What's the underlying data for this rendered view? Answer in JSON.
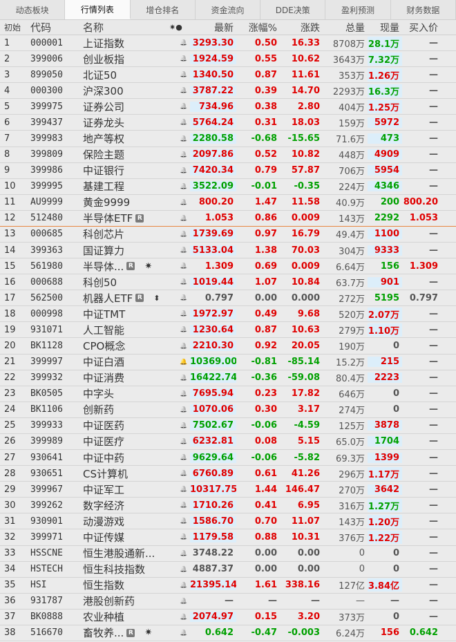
{
  "tabs": [
    "动态板块",
    "行情列表",
    "增仓排名",
    "资金流向",
    "DDE决策",
    "盈利预测",
    "财务数据"
  ],
  "active_tab": 1,
  "header": {
    "idx": "初始",
    "code": "代码",
    "name": "名称",
    "mark": "✷●",
    "price": "最新",
    "pct": "涨幅%",
    "chg": "涨跌",
    "vol": "总量",
    "now": "现量",
    "bid": "买入价"
  },
  "rows": [
    {
      "idx": "1",
      "code": "000001",
      "name": "上证指数",
      "price": "3293.30",
      "pct": "0.50",
      "chg": "16.33",
      "vol": "8708万",
      "now": "28.1万",
      "bid": "—",
      "pc": "red",
      "nc": "green",
      "hlp": true,
      "hln": true
    },
    {
      "idx": "2",
      "code": "399006",
      "name": "创业板指",
      "price": "1924.59",
      "pct": "0.55",
      "chg": "10.62",
      "vol": "3643万",
      "now": "7.32万",
      "bid": "—",
      "pc": "red",
      "nc": "green",
      "hlp": true,
      "hln": true
    },
    {
      "idx": "3",
      "code": "899050",
      "name": "北证50",
      "price": "1340.50",
      "pct": "0.87",
      "chg": "11.61",
      "vol": "353万",
      "now": "1.26万",
      "bid": "—",
      "pc": "red",
      "nc": "red",
      "hlp": true,
      "hln": true
    },
    {
      "idx": "4",
      "code": "000300",
      "name": "沪深300",
      "price": "3787.22",
      "pct": "0.39",
      "chg": "14.70",
      "vol": "2293万",
      "now": "16.3万",
      "bid": "—",
      "pc": "red",
      "nc": "green",
      "hlp": true,
      "hln": true
    },
    {
      "idx": "5",
      "code": "399975",
      "name": "证券公司",
      "price": "734.96",
      "pct": "0.38",
      "chg": "2.80",
      "vol": "404万",
      "now": "1.25万",
      "bid": "—",
      "pc": "red",
      "nc": "red",
      "hlp": true,
      "hln": true
    },
    {
      "idx": "6",
      "code": "399437",
      "name": "证券龙头",
      "price": "5764.24",
      "pct": "0.31",
      "chg": "18.03",
      "vol": "159万",
      "now": "5972",
      "bid": "—",
      "pc": "red",
      "nc": "red",
      "hlp": true,
      "hln": true
    },
    {
      "idx": "7",
      "code": "399983",
      "name": "地产等权",
      "price": "2280.58",
      "pct": "-0.68",
      "chg": "-15.65",
      "vol": "71.6万",
      "now": "473",
      "bid": "—",
      "pc": "green",
      "nc": "green",
      "hlp": true,
      "hln": true
    },
    {
      "idx": "8",
      "code": "399809",
      "name": "保险主题",
      "price": "2097.86",
      "pct": "0.52",
      "chg": "10.82",
      "vol": "448万",
      "now": "4909",
      "bid": "—",
      "pc": "red",
      "nc": "red",
      "hlp": true,
      "hln": true
    },
    {
      "idx": "9",
      "code": "399986",
      "name": "中证银行",
      "price": "7420.34",
      "pct": "0.79",
      "chg": "57.87",
      "vol": "706万",
      "now": "5954",
      "bid": "—",
      "pc": "red",
      "nc": "red",
      "hlp": true,
      "hln": true
    },
    {
      "idx": "10",
      "code": "399995",
      "name": "基建工程",
      "price": "3522.09",
      "pct": "-0.01",
      "chg": "-0.35",
      "vol": "224万",
      "now": "4346",
      "bid": "—",
      "pc": "green",
      "nc": "green",
      "hlp": true,
      "hln": true
    },
    {
      "idx": "11",
      "code": "AU9999",
      "name": "黄金9999",
      "price": "800.20",
      "pct": "1.47",
      "chg": "11.58",
      "vol": "40.9万",
      "now": "200",
      "bid": "800.20",
      "pc": "red",
      "nc": "green",
      "hlp": false,
      "hln": false
    },
    {
      "idx": "12",
      "code": "512480",
      "name": "半导体ETF",
      "badge": "R",
      "price": "1.053",
      "pct": "0.86",
      "chg": "0.009",
      "vol": "143万",
      "now": "2292",
      "bid": "1.053",
      "pc": "red",
      "nc": "green",
      "hlp": false,
      "hln": false,
      "sep": true
    },
    {
      "idx": "13",
      "code": "000685",
      "name": "科创芯片",
      "price": "1739.69",
      "pct": "0.97",
      "chg": "16.79",
      "vol": "49.4万",
      "now": "1100",
      "bid": "—",
      "pc": "red",
      "nc": "red",
      "hlp": true,
      "hln": true
    },
    {
      "idx": "14",
      "code": "399363",
      "name": "国证算力",
      "price": "5133.04",
      "pct": "1.38",
      "chg": "70.03",
      "vol": "304万",
      "now": "9333",
      "bid": "—",
      "pc": "red",
      "nc": "red",
      "hlp": true,
      "hln": true
    },
    {
      "idx": "15",
      "code": "561980",
      "name": "半导体...",
      "badge": "R",
      "star": "✷",
      "price": "1.309",
      "pct": "0.69",
      "chg": "0.009",
      "vol": "6.64万",
      "now": "156",
      "bid": "1.309",
      "pc": "red",
      "nc": "green",
      "hlp": false,
      "hln": false
    },
    {
      "idx": "16",
      "code": "000688",
      "name": "科创50",
      "price": "1019.44",
      "pct": "1.07",
      "chg": "10.84",
      "vol": "63.7万",
      "now": "901",
      "bid": "—",
      "pc": "red",
      "nc": "red",
      "hlp": true,
      "hln": true
    },
    {
      "idx": "17",
      "code": "562500",
      "name": "机器人ETF",
      "badge": "R",
      "updn": "⬍",
      "price": "0.797",
      "pct": "0.00",
      "chg": "0.000",
      "vol": "272万",
      "now": "5195",
      "bid": "0.797",
      "pc": "gray",
      "nc": "green",
      "hlp": false,
      "hln": false
    },
    {
      "idx": "18",
      "code": "000998",
      "name": "中证TMT",
      "price": "1972.97",
      "pct": "0.49",
      "chg": "9.68",
      "vol": "520万",
      "now": "2.07万",
      "bid": "—",
      "pc": "red",
      "nc": "red",
      "hlp": true,
      "hln": true
    },
    {
      "idx": "19",
      "code": "931071",
      "name": "人工智能",
      "price": "1230.64",
      "pct": "0.87",
      "chg": "10.63",
      "vol": "279万",
      "now": "1.10万",
      "bid": "—",
      "pc": "red",
      "nc": "red",
      "hlp": true,
      "hln": true
    },
    {
      "idx": "20",
      "code": "BK1128",
      "name": "CPO概念",
      "price": "2210.30",
      "pct": "0.92",
      "chg": "20.05",
      "vol": "190万",
      "now": "0",
      "bid": "—",
      "pc": "red",
      "nc": "gray",
      "hlp": true,
      "hln": false
    },
    {
      "idx": "21",
      "code": "399997",
      "name": "中证白酒",
      "alert": true,
      "price": "10369.00",
      "pct": "-0.81",
      "chg": "-85.14",
      "vol": "15.2万",
      "now": "215",
      "bid": "—",
      "pc": "green",
      "nc": "red",
      "hlp": true,
      "hln": true
    },
    {
      "idx": "22",
      "code": "399932",
      "name": "中证消费",
      "price": "16422.74",
      "pct": "-0.36",
      "chg": "-59.08",
      "vol": "80.4万",
      "now": "2223",
      "bid": "—",
      "pc": "green",
      "nc": "red",
      "hlp": true,
      "hln": true
    },
    {
      "idx": "23",
      "code": "BK0505",
      "name": "中字头",
      "price": "7695.94",
      "pct": "0.23",
      "chg": "17.82",
      "vol": "646万",
      "now": "0",
      "bid": "—",
      "pc": "red",
      "nc": "gray",
      "hlp": true,
      "hln": false
    },
    {
      "idx": "24",
      "code": "BK1106",
      "name": "创新药",
      "price": "1070.06",
      "pct": "0.30",
      "chg": "3.17",
      "vol": "274万",
      "now": "0",
      "bid": "—",
      "pc": "red",
      "nc": "gray",
      "hlp": true,
      "hln": false
    },
    {
      "idx": "25",
      "code": "399933",
      "name": "中证医药",
      "price": "7502.67",
      "pct": "-0.06",
      "chg": "-4.59",
      "vol": "125万",
      "now": "3878",
      "bid": "—",
      "pc": "green",
      "nc": "red",
      "hlp": true,
      "hln": true
    },
    {
      "idx": "26",
      "code": "399989",
      "name": "中证医疗",
      "price": "6232.81",
      "pct": "0.08",
      "chg": "5.15",
      "vol": "65.0万",
      "now": "1704",
      "bid": "—",
      "pc": "red",
      "nc": "green",
      "hlp": true,
      "hln": true
    },
    {
      "idx": "27",
      "code": "930641",
      "name": "中证中药",
      "price": "9629.64",
      "pct": "-0.06",
      "chg": "-5.82",
      "vol": "69.3万",
      "now": "1399",
      "bid": "—",
      "pc": "green",
      "nc": "red",
      "hlp": true,
      "hln": true
    },
    {
      "idx": "28",
      "code": "930651",
      "name": "CS计算机",
      "price": "6760.89",
      "pct": "0.61",
      "chg": "41.26",
      "vol": "296万",
      "now": "1.17万",
      "bid": "—",
      "pc": "red",
      "nc": "red",
      "hlp": true,
      "hln": true
    },
    {
      "idx": "29",
      "code": "399967",
      "name": "中证军工",
      "price": "10317.75",
      "pct": "1.44",
      "chg": "146.47",
      "vol": "270万",
      "now": "3642",
      "bid": "—",
      "pc": "red",
      "nc": "red",
      "hlp": true,
      "hln": true
    },
    {
      "idx": "30",
      "code": "399262",
      "name": "数字经济",
      "price": "1710.26",
      "pct": "0.41",
      "chg": "6.95",
      "vol": "316万",
      "now": "1.27万",
      "bid": "—",
      "pc": "red",
      "nc": "green",
      "hlp": true,
      "hln": true
    },
    {
      "idx": "31",
      "code": "930901",
      "name": "动漫游戏",
      "price": "1586.70",
      "pct": "0.70",
      "chg": "11.07",
      "vol": "143万",
      "now": "1.20万",
      "bid": "—",
      "pc": "red",
      "nc": "red",
      "hlp": true,
      "hln": true
    },
    {
      "idx": "32",
      "code": "399971",
      "name": "中证传媒",
      "price": "1179.58",
      "pct": "0.88",
      "chg": "10.31",
      "vol": "376万",
      "now": "1.22万",
      "bid": "—",
      "pc": "red",
      "nc": "red",
      "hlp": true,
      "hln": true
    },
    {
      "idx": "33",
      "code": "HSSCNE",
      "name": "恒生港股通新...",
      "price": "3748.22",
      "pct": "0.00",
      "chg": "0.00",
      "vol": "0",
      "now": "0",
      "bid": "—",
      "pc": "gray",
      "nc": "gray",
      "hlp": false,
      "hln": false
    },
    {
      "idx": "34",
      "code": "HSTECH",
      "name": "恒生科技指数",
      "price": "4887.37",
      "pct": "0.00",
      "chg": "0.00",
      "vol": "0",
      "now": "0",
      "bid": "—",
      "pc": "gray",
      "nc": "gray",
      "hlp": false,
      "hln": false
    },
    {
      "idx": "35",
      "code": "HSI",
      "name": "恒生指数",
      "price": "21395.14",
      "pct": "1.61",
      "chg": "338.16",
      "vol": "127亿",
      "now": "3.84亿",
      "bid": "—",
      "pc": "red",
      "nc": "red",
      "hlp": true,
      "hln": true
    },
    {
      "idx": "36",
      "code": "931787",
      "name": "港股创新药",
      "price": "—",
      "pct": "—",
      "chg": "—",
      "vol": "—",
      "now": "—",
      "bid": "—",
      "pc": "gray",
      "nc": "gray",
      "hlp": false,
      "hln": false
    },
    {
      "idx": "37",
      "code": "BK0888",
      "name": "农业种植",
      "price": "2074.97",
      "pct": "0.15",
      "chg": "3.20",
      "vol": "373万",
      "now": "0",
      "bid": "—",
      "pc": "red",
      "nc": "gray",
      "hlp": true,
      "hln": false
    },
    {
      "idx": "38",
      "code": "516670",
      "name": "畜牧养...",
      "badge": "R",
      "star": "✷",
      "price": "0.642",
      "pct": "-0.47",
      "chg": "-0.003",
      "vol": "6.24万",
      "now": "156",
      "bid": "0.642",
      "pc": "green",
      "nc": "red",
      "hlp": false,
      "hln": false
    }
  ]
}
